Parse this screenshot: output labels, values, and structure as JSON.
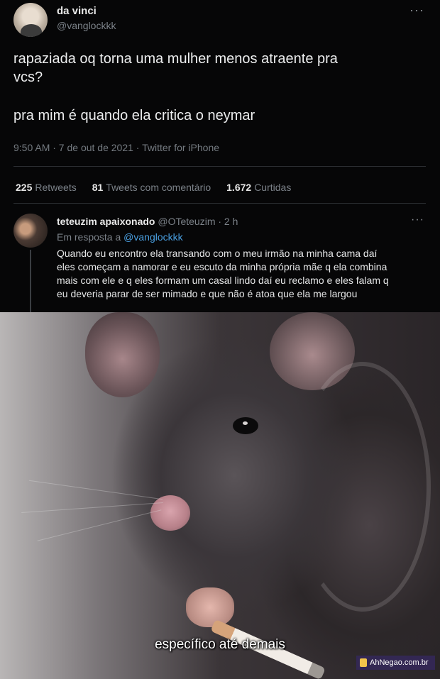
{
  "tweet": {
    "author_name": "da vinci",
    "author_handle": "@vanglockkk",
    "more_icon": "···",
    "text_line1": "rapaziada oq torna uma mulher menos atraente pra",
    "text_line2": "vcs?",
    "text_line3": "pra mim é quando ela critica o neymar",
    "meta": "9:50 AM · 7 de out de 2021 · Twitter for iPhone",
    "stats": {
      "retweets_count": "225",
      "retweets_label": "Retweets",
      "quote_count": "81",
      "quote_label": "Tweets com comentário",
      "likes_count": "1.672",
      "likes_label": "Curtidas"
    }
  },
  "reply": {
    "author_name": "teteuzim apaixonado",
    "author_handle_time": "@OTeteuzim · 2 h",
    "more_icon": "···",
    "reply_to_prefix": "Em resposta a",
    "reply_to_handle": "@vanglockkk",
    "lines": [
      "Quando eu encontro ela transando com o meu irmão na minha cama daí",
      "eles começam a namorar e eu escuto da minha própria mãe q ela combina",
      "mais com ele e q eles formam um casal lindo daí eu reclamo e eles falam q",
      "eu deveria parar de ser mimado e que não é atoa que ela me largou"
    ]
  },
  "meme": {
    "caption": "específico até demais",
    "watermark": "AhNegao.com.br"
  }
}
